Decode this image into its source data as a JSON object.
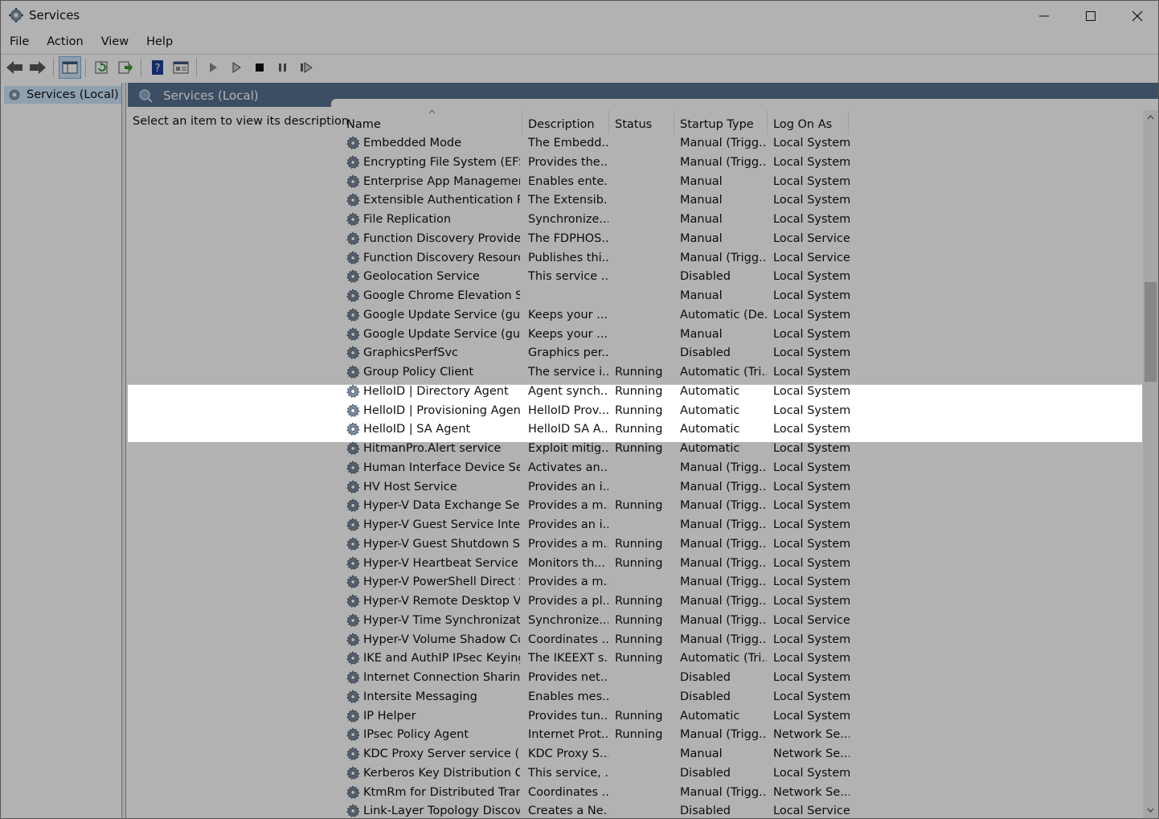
{
  "window": {
    "title": "Services"
  },
  "menu": [
    "File",
    "Action",
    "View",
    "Help"
  ],
  "tree": {
    "root_label": "Services (Local)"
  },
  "pane": {
    "header_title": "Services (Local)",
    "description_hint": "Select an item to view its description."
  },
  "columns": [
    "Name",
    "Description",
    "Status",
    "Startup Type",
    "Log On As"
  ],
  "rows": [
    {
      "name": "Embedded Mode",
      "desc": "The Embedd...",
      "status": "",
      "startup": "Manual (Trigg...",
      "logon": "Local System"
    },
    {
      "name": "Encrypting File System (EFS)",
      "desc": "Provides the...",
      "status": "",
      "startup": "Manual (Trigg...",
      "logon": "Local System"
    },
    {
      "name": "Enterprise App Managemen...",
      "desc": "Enables ente...",
      "status": "",
      "startup": "Manual",
      "logon": "Local System"
    },
    {
      "name": "Extensible Authentication Pr...",
      "desc": "The Extensib...",
      "status": "",
      "startup": "Manual",
      "logon": "Local System"
    },
    {
      "name": "File Replication",
      "desc": "Synchronize...",
      "status": "",
      "startup": "Manual",
      "logon": "Local System"
    },
    {
      "name": "Function Discovery Provider ...",
      "desc": "The FDPHOS...",
      "status": "",
      "startup": "Manual",
      "logon": "Local Service"
    },
    {
      "name": "Function Discovery Resourc...",
      "desc": "Publishes thi...",
      "status": "",
      "startup": "Manual (Trigg...",
      "logon": "Local Service"
    },
    {
      "name": "Geolocation Service",
      "desc": "This service ...",
      "status": "",
      "startup": "Disabled",
      "logon": "Local System"
    },
    {
      "name": "Google Chrome Elevation Se...",
      "desc": "",
      "status": "",
      "startup": "Manual",
      "logon": "Local System"
    },
    {
      "name": "Google Update Service (gup...",
      "desc": "Keeps your ...",
      "status": "",
      "startup": "Automatic (De...",
      "logon": "Local System"
    },
    {
      "name": "Google Update Service (gup...",
      "desc": "Keeps your ...",
      "status": "",
      "startup": "Manual",
      "logon": "Local System"
    },
    {
      "name": "GraphicsPerfSvc",
      "desc": "Graphics per...",
      "status": "",
      "startup": "Disabled",
      "logon": "Local System"
    },
    {
      "name": "Group Policy Client",
      "desc": "The service i...",
      "status": "Running",
      "startup": "Automatic (Tri...",
      "logon": "Local System"
    },
    {
      "name": "HelloID | Directory Agent",
      "desc": "Agent synch...",
      "status": "Running",
      "startup": "Automatic",
      "logon": "Local System",
      "highlight": true
    },
    {
      "name": "HelloID | Provisioning Agent",
      "desc": "HelloID Prov...",
      "status": "Running",
      "startup": "Automatic",
      "logon": "Local System",
      "highlight": true
    },
    {
      "name": "HelloID | SA Agent",
      "desc": "HelloID SA A...",
      "status": "Running",
      "startup": "Automatic",
      "logon": "Local System",
      "highlight": true
    },
    {
      "name": "HitmanPro.Alert service",
      "desc": "Exploit mitig...",
      "status": "Running",
      "startup": "Automatic",
      "logon": "Local System"
    },
    {
      "name": "Human Interface Device Serv...",
      "desc": "Activates an...",
      "status": "",
      "startup": "Manual (Trigg...",
      "logon": "Local System"
    },
    {
      "name": "HV Host Service",
      "desc": "Provides an i...",
      "status": "",
      "startup": "Manual (Trigg...",
      "logon": "Local System"
    },
    {
      "name": "Hyper-V Data Exchange Serv...",
      "desc": "Provides a m...",
      "status": "Running",
      "startup": "Manual (Trigg...",
      "logon": "Local System"
    },
    {
      "name": "Hyper-V Guest Service Interf...",
      "desc": "Provides an i...",
      "status": "",
      "startup": "Manual (Trigg...",
      "logon": "Local System"
    },
    {
      "name": "Hyper-V Guest Shutdown Se...",
      "desc": "Provides a m...",
      "status": "Running",
      "startup": "Manual (Trigg...",
      "logon": "Local System"
    },
    {
      "name": "Hyper-V Heartbeat Service",
      "desc": "Monitors th...",
      "status": "Running",
      "startup": "Manual (Trigg...",
      "logon": "Local System"
    },
    {
      "name": "Hyper-V PowerShell Direct S...",
      "desc": "Provides a m...",
      "status": "",
      "startup": "Manual (Trigg...",
      "logon": "Local System"
    },
    {
      "name": "Hyper-V Remote Desktop Vi...",
      "desc": "Provides a pl...",
      "status": "Running",
      "startup": "Manual (Trigg...",
      "logon": "Local System"
    },
    {
      "name": "Hyper-V Time Synchronizati...",
      "desc": "Synchronize...",
      "status": "Running",
      "startup": "Manual (Trigg...",
      "logon": "Local Service"
    },
    {
      "name": "Hyper-V Volume Shadow Co...",
      "desc": "Coordinates ...",
      "status": "Running",
      "startup": "Manual (Trigg...",
      "logon": "Local System"
    },
    {
      "name": "IKE and AuthIP IPsec Keying ...",
      "desc": "The IKEEXT s...",
      "status": "Running",
      "startup": "Automatic (Tri...",
      "logon": "Local System"
    },
    {
      "name": "Internet Connection Sharing...",
      "desc": "Provides net...",
      "status": "",
      "startup": "Disabled",
      "logon": "Local System"
    },
    {
      "name": "Intersite Messaging",
      "desc": "Enables mes...",
      "status": "",
      "startup": "Disabled",
      "logon": "Local System"
    },
    {
      "name": "IP Helper",
      "desc": "Provides tun...",
      "status": "Running",
      "startup": "Automatic",
      "logon": "Local System"
    },
    {
      "name": "IPsec Policy Agent",
      "desc": "Internet Prot...",
      "status": "Running",
      "startup": "Manual (Trigg...",
      "logon": "Network Se..."
    },
    {
      "name": "KDC Proxy Server service (KPS)",
      "desc": "KDC Proxy S...",
      "status": "",
      "startup": "Manual",
      "logon": "Network Se..."
    },
    {
      "name": "Kerberos Key Distribution C...",
      "desc": "This service, ...",
      "status": "",
      "startup": "Disabled",
      "logon": "Local System"
    },
    {
      "name": "KtmRm for Distributed Trans...",
      "desc": "Coordinates ...",
      "status": "",
      "startup": "Manual (Trigg...",
      "logon": "Network Se..."
    },
    {
      "name": "Link-Layer Topology Discove...",
      "desc": "Creates a Ne...",
      "status": "",
      "startup": "Disabled",
      "logon": "Local Service"
    }
  ]
}
